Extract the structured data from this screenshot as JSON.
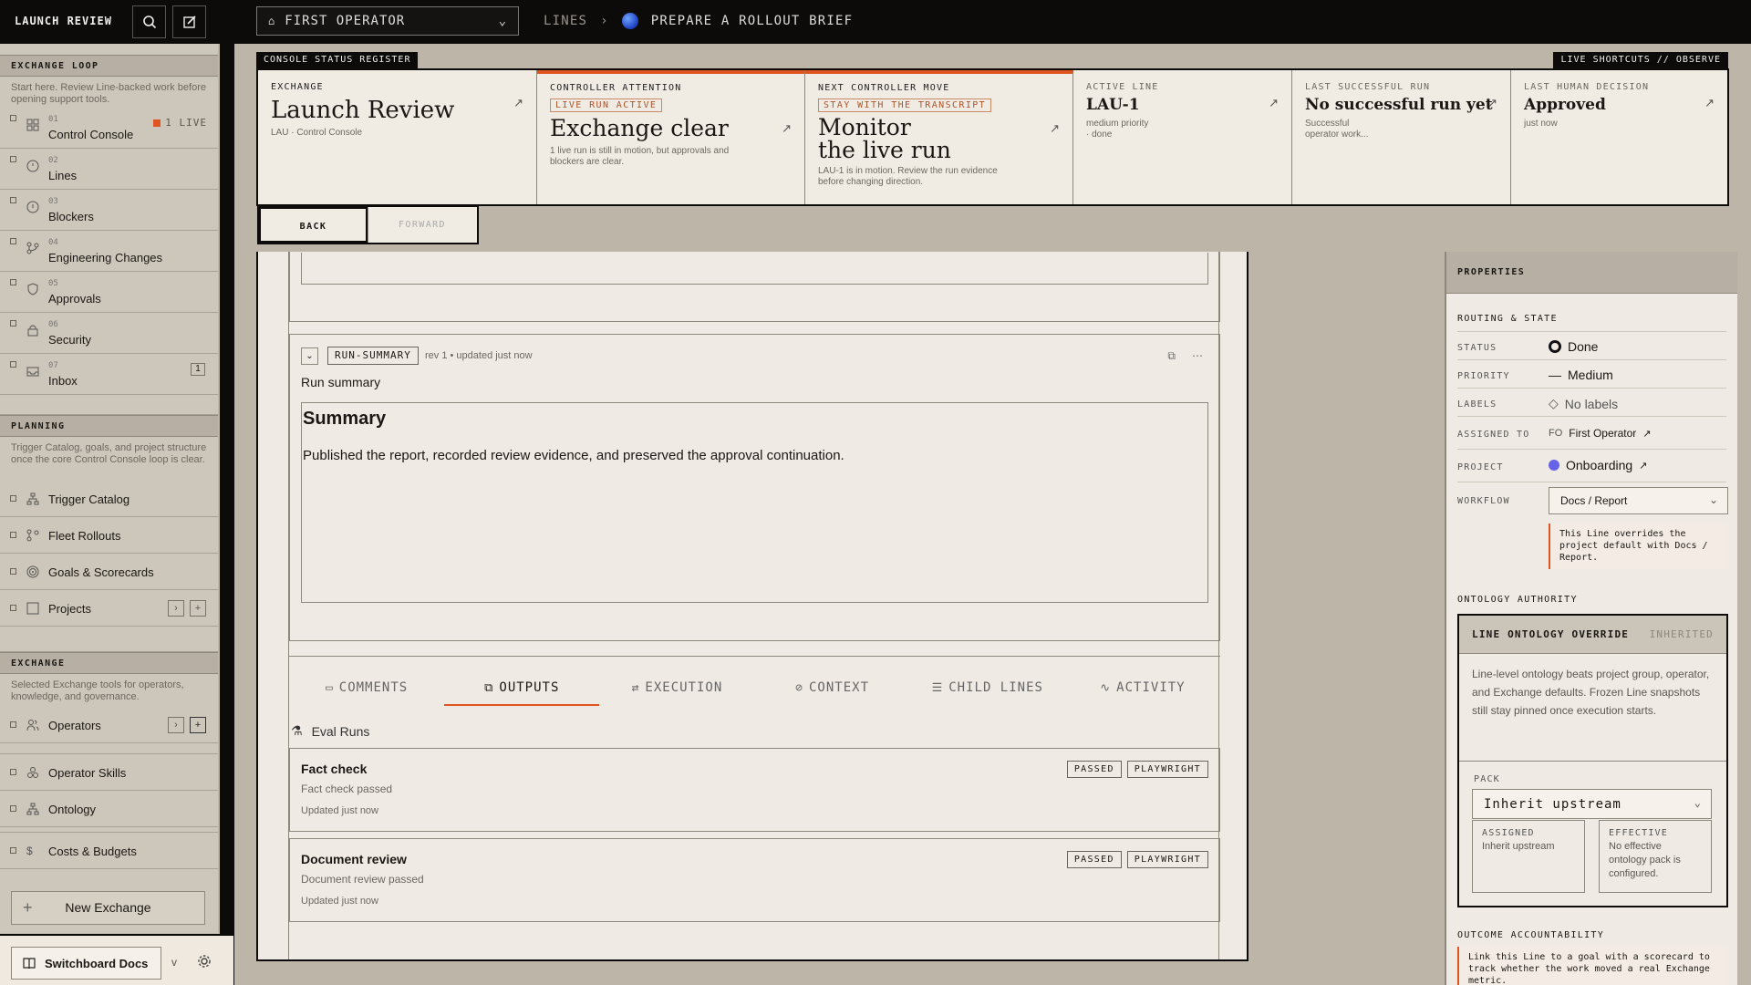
{
  "app": {
    "title": "LAUNCH REVIEW"
  },
  "operator_select": {
    "value": "FIRST OPERATOR"
  },
  "breadcrumb": {
    "section": "LINES",
    "current": "PREPARE A ROLLOUT BRIEF"
  },
  "sidebar": {
    "exchange_loop": {
      "heading": "EXCHANGE LOOP",
      "description": "Start here. Review Line-backed work before opening support tools.",
      "items": [
        {
          "num": "01",
          "label": "Control Console",
          "badge": "1 LIVE"
        },
        {
          "num": "02",
          "label": "Lines"
        },
        {
          "num": "03",
          "label": "Blockers"
        },
        {
          "num": "04",
          "label": "Engineering Changes"
        },
        {
          "num": "05",
          "label": "Approvals"
        },
        {
          "num": "06",
          "label": "Security"
        },
        {
          "num": "07",
          "label": "Inbox",
          "count": "1"
        }
      ]
    },
    "planning": {
      "heading": "PLANNING",
      "description": "Trigger Catalog, goals, and project structure once the core Control Console loop is clear.",
      "items": [
        "Trigger Catalog",
        "Fleet Rollouts",
        "Goals & Scorecards",
        "Projects"
      ]
    },
    "exchange": {
      "heading": "EXCHANGE",
      "description": "Selected Exchange tools for operators, knowledge, and governance.",
      "items": [
        "Operators",
        "Operator Skills",
        "Ontology",
        "Costs & Budgets"
      ]
    },
    "new_exchange": "New Exchange",
    "footer": {
      "docs": "Switchboard Docs",
      "version": "v"
    }
  },
  "register": {
    "label": "CONSOLE STATUS REGISTER",
    "shortcuts": "LIVE SHORTCUTS // OBSERVE",
    "cells": {
      "exchange": {
        "key": "EXCHANGE",
        "value": "Launch Review",
        "sub": "LAU · Control Console"
      },
      "attention": {
        "key": "CONTROLLER ATTENTION",
        "tag": "LIVE RUN ACTIVE",
        "value": "Exchange clear",
        "sub": "1 live run is still in motion, but approvals and blockers are clear."
      },
      "next": {
        "key": "NEXT CONTROLLER MOVE",
        "tag": "STAY WITH THE TRANSCRIPT",
        "value_line1": "Monitor",
        "value_line2": "the live run",
        "sub": "LAU-1 is in motion. Review the run evidence before changing direction."
      },
      "active_line": {
        "key": "ACTIVE LINE",
        "value": "LAU-1",
        "sub1": "medium priority",
        "sub2": "· done"
      },
      "last_run": {
        "key": "LAST SUCCESSFUL RUN",
        "value": "No successful run yet",
        "sub1": "Successful",
        "sub2": "operator work..."
      },
      "last_decision": {
        "key": "LAST HUMAN DECISION",
        "value": "Approved",
        "sub": "just now"
      }
    },
    "back": "BACK",
    "forward": "FORWARD"
  },
  "run_card": {
    "tag": "RUN-SUMMARY",
    "meta": "rev 1 • updated just now",
    "title": "Run summary",
    "heading": "Summary",
    "body": "Published the report, recorded review evidence, and preserved the approval continuation."
  },
  "tabs": [
    "COMMENTS",
    "OUTPUTS",
    "EXECUTION",
    "CONTEXT",
    "CHILD LINES",
    "ACTIVITY"
  ],
  "eval": {
    "heading": "Eval Runs",
    "runs": [
      {
        "name": "Fact check",
        "desc": "Fact check passed",
        "updated": "Updated just now",
        "status": "PASSED",
        "tool": "PLAYWRIGHT"
      },
      {
        "name": "Document review",
        "desc": "Document review passed",
        "updated": "Updated just now",
        "status": "PASSED",
        "tool": "PLAYWRIGHT"
      }
    ]
  },
  "properties": {
    "heading": "PROPERTIES",
    "routing_heading": "ROUTING & STATE",
    "rows": {
      "status": {
        "key": "STATUS",
        "value": "Done"
      },
      "priority": {
        "key": "PRIORITY",
        "value": "Medium"
      },
      "labels": {
        "key": "LABELS",
        "value": "No labels"
      },
      "assigned": {
        "key": "ASSIGNED TO",
        "initials": "FO",
        "value": "First Operator"
      },
      "project": {
        "key": "PROJECT",
        "value": "Onboarding"
      },
      "workflow": {
        "key": "WORKFLOW",
        "value": "Docs / Report"
      }
    },
    "workflow_note": "This Line overrides the project default with Docs / Report.",
    "ontology_heading": "ONTOLOGY AUTHORITY",
    "ontology": {
      "title": "LINE ONTOLOGY OVERRIDE",
      "inherited": "INHERITED",
      "description": "Line-level ontology beats project group, operator, and Exchange defaults. Frozen Line snapshots still stay pinned once execution starts.",
      "pack_label": "PACK",
      "pack_value": "Inherit upstream",
      "assigned_label": "ASSIGNED",
      "assigned_value": "Inherit upstream",
      "effective_label": "EFFECTIVE",
      "effective_value": "No effective ontology pack is configured."
    },
    "outcome_heading": "OUTCOME ACCOUNTABILITY",
    "outcome_note": "Link this Line to a goal with a scorecard to track whether the work moved a real Exchange metric."
  }
}
